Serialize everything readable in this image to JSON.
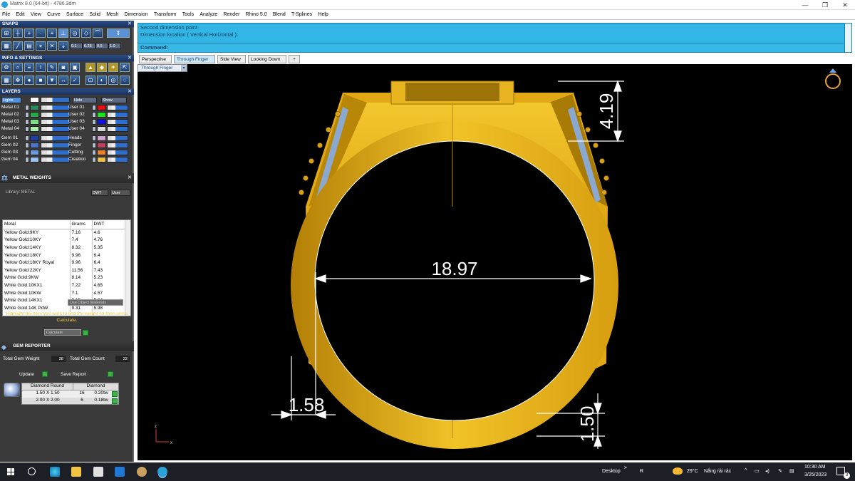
{
  "window": {
    "title": "Matrix 8.0 (64-bit) - 4786.3dm",
    "minimize": "—",
    "maximize": "❐",
    "close": "✕"
  },
  "menu": [
    "File",
    "Edit",
    "View",
    "Curve",
    "Surface",
    "Solid",
    "Mesh",
    "Dimension",
    "Transform",
    "Tools",
    "Analyze",
    "Render",
    "Rhino 5.0",
    "Blend",
    "T-Splines",
    "Help"
  ],
  "panels": {
    "snaps": "SNAPS",
    "snap_values": [
      "0.1",
      "0.25",
      "0.5",
      "1.0"
    ],
    "info_settings": "INFO & SETTINGS",
    "layers": "LAYERS",
    "metal_weights": "METAL WEIGHTS",
    "gem_reporter": "GEM REPORTER"
  },
  "layers": {
    "lights_label": "Lights",
    "hide_label": "Hide",
    "show_label": "Show",
    "left": [
      {
        "name": "Metal 01",
        "color": "#2e8b57"
      },
      {
        "name": "Metal 02",
        "color": "#27a64a"
      },
      {
        "name": "Metal 03",
        "color": "#7ee08a"
      },
      {
        "name": "Metal 04",
        "color": "#a9efb0"
      },
      {
        "name": "Gem 01",
        "color": "#1f3fa8"
      },
      {
        "name": "Gem 02",
        "color": "#4d73c9"
      },
      {
        "name": "Gem 03",
        "color": "#6a9be0"
      },
      {
        "name": "Gem 04",
        "color": "#9ec2f2"
      }
    ],
    "right": [
      {
        "name": "User 01",
        "color": "#e01010"
      },
      {
        "name": "User 02",
        "color": "#20e020"
      },
      {
        "name": "User 03",
        "color": "#1010e0"
      },
      {
        "name": "User 04",
        "color": "#d8d8d8"
      },
      {
        "name": "Heads",
        "color": "#d0a0d0"
      },
      {
        "name": "Finger",
        "color": "#c04060"
      },
      {
        "name": "Cutting",
        "color": "#f08020"
      },
      {
        "name": "Creation",
        "color": "#f0c040"
      }
    ]
  },
  "metal_weights": {
    "library_label": "Library: METAL",
    "unit_label": "DWT",
    "user_label": "User",
    "columns": [
      "Metal",
      "Grams",
      "DWT"
    ],
    "rows": [
      [
        "Yellow Gold:9KY",
        "7.16",
        "4.6"
      ],
      [
        "Yellow Gold:10KY",
        "7.4",
        "4.76"
      ],
      [
        "Yellow Gold:14KY",
        "8.32",
        "5.35"
      ],
      [
        "Yellow Gold:18KY",
        "9.96",
        "6.4"
      ],
      [
        "Yellow Gold:18KY Royal",
        "9.96",
        "6.4"
      ],
      [
        "Yellow Gold:22KY",
        "11.56",
        "7.43"
      ],
      [
        "White Gold:9KW",
        "8.14",
        "5.23"
      ],
      [
        "White Gold:10KX1",
        "7.22",
        "4.65"
      ],
      [
        "White Gold:10KW",
        "7.1",
        "4.57"
      ],
      [
        "White Gold:14KX1",
        "8.15",
        "5.24"
      ],
      [
        "White Gold:14K PdW",
        "9.31",
        "5.98"
      ]
    ],
    "use_object_materials": "Use Object Materials",
    "hint": "Highlight the item you want to find the weight for then press Calculate.",
    "calculate": "Calculate"
  },
  "gem_reporter": {
    "total_weight_label": "Total Gem Weight",
    "total_weight": "38",
    "total_count_label": "Total Gem Count",
    "total_count": "22",
    "update": "Update",
    "save_report": "Save Report",
    "header": [
      "Diamond Round",
      "Diamond"
    ],
    "rows": [
      [
        "1.50 X 1.50",
        "16",
        "0.20tw"
      ],
      [
        "2.00 X 2.00",
        "6",
        "0.18tw"
      ]
    ]
  },
  "command": {
    "line1": "Second dimension point",
    "line2": "Dimension location ( Vertical  Horizontal ):",
    "prompt": "Command:"
  },
  "viewport_tabs": [
    "Perspective",
    "Through Finger",
    "Side View",
    "Looking Down",
    "+"
  ],
  "active_tab": "Through Finger",
  "viewport_label": "Through Finger",
  "dimensions": {
    "inner_diameter": "18.97",
    "top_height": "4.19",
    "shank_width": "1.58",
    "bottom_thickness": "1.50"
  },
  "axis": {
    "z": "z",
    "x": "x"
  },
  "taskbar": {
    "desktop": "Desktop",
    "weather_temp": "29°C",
    "weather_text": "Nắng rải rác",
    "time": "10:30 AM",
    "date": "3/25/2023",
    "notification_count": "3"
  },
  "colors": {
    "gold": "#e6b31e",
    "command_bg": "#33b5e5",
    "panel_header": "#1b3263"
  }
}
